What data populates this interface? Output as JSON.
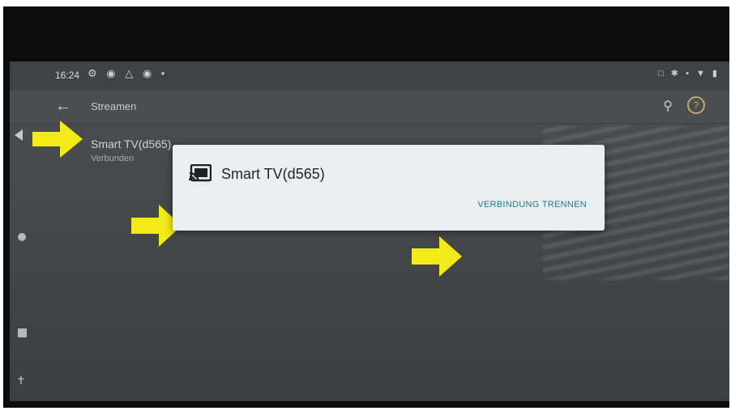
{
  "status_bar": {
    "time": "16:24",
    "left_icons": "⚙ ◉ △ ◉ •",
    "right_icons": "□ ✱ • ▼ ▮"
  },
  "app_bar": {
    "title": "Streamen",
    "back_icon": "back-arrow-icon",
    "search_icon": "search-icon",
    "help_icon": "help-icon"
  },
  "device_list": [
    {
      "name": "Smart TV(d565)",
      "status": "Verbunden"
    }
  ],
  "dialog": {
    "title": "Smart TV(d565)",
    "icon": "cast-icon",
    "action_label": "VERBINDUNG TRENNEN"
  },
  "annotation": {
    "arrow_color": "#f3ea1a"
  },
  "colors": {
    "dialog_bg": "#ecedee",
    "accent": "#1f7f80",
    "screen_bg": "#464a4c"
  }
}
